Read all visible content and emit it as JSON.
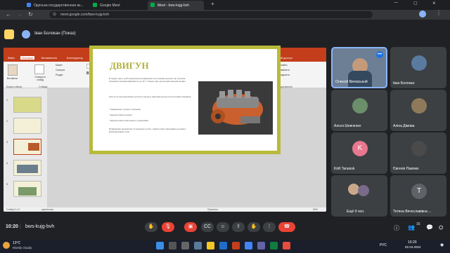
{
  "browser": {
    "tabs": [
      {
        "label": "Одеська государственная ак...",
        "active": false,
        "color": "#4285f4"
      },
      {
        "label": "Google Meet",
        "active": false,
        "color": "#00ac47"
      },
      {
        "label": "Meet - bws-kujg-bvh",
        "active": true,
        "color": "#00ac47"
      }
    ],
    "url": "meet.google.com/bws-kujg-bvh"
  },
  "meet_header": {
    "presenter": "Іван Болокан (Показ)"
  },
  "powerpoint": {
    "title": "ТЕМА 5 - PowerPoint",
    "share_button": "Поділ",
    "menu": [
      "Файл",
      "Основне",
      "Вставлення",
      "Конструктор",
      "Переходи",
      "Анімація",
      "Показ слайдів",
      "Рецензування",
      "Подання",
      "Довідка",
      "Foxit PDF",
      "Дизайнер",
      "Спільний доступ"
    ],
    "ribbon_groups": [
      "Буфер обміну",
      "Слайди",
      "Шрифт",
      "Абзац",
      "Малювання",
      "Редагування"
    ],
    "ribbon_buttons": [
      "Вставити",
      "Створити слайд",
      "Макет",
      "Скинути",
      "Розділ",
      "Фігури",
      "Упорядкувати",
      "Стилі фігур",
      "Знайти",
      "Замінити",
      "Виділити"
    ],
    "slide": {
      "title": "ДВИГУН",
      "paragraphs": [
        "В першу чергу треба відзначити розширення застосування дизелів, що дозволяє збільшити вантажопідйомність до 20 т і більше при одночасній економії палива.",
        "Робота по вдосконаленню робочого процесу двигунів ведеться в наступних напрямах:",
        "• підвищення ступеня стиснення;",
        "• використання наддуву;",
        "• використання електронного управління.",
        "Підвищення економічності покращує розгін і знижує вміст шкідливих речовин у відпрацьованих газах."
      ]
    },
    "status": {
      "slide_counter": "Слайд 3 з 9",
      "language": "українська",
      "notes": "Примітки",
      "zoom": "55%"
    },
    "thumbs": [
      "1",
      "2",
      "3",
      "4",
      "5"
    ],
    "selected_slide": 3
  },
  "participants": [
    {
      "name": "Олексій Виговськнй",
      "type": "video",
      "active": true
    },
    {
      "name": "Іван Болокан",
      "type": "video"
    },
    {
      "name": "Алєся Шевченко",
      "type": "avatar",
      "color": "#6b8e6b"
    },
    {
      "name": "Аліна Дімова",
      "type": "avatar",
      "color": "#8e7a5a"
    },
    {
      "name": "Kirill Tarasiuk",
      "type": "letter",
      "letter": "K",
      "color": "#e8778f"
    },
    {
      "name": "Євгенія Павлюк",
      "type": "avatar",
      "color": "#4a4a4a"
    },
    {
      "name": "Ещё 9 чел.",
      "type": "more"
    },
    {
      "name": "Тетяна Вячеславівна ...",
      "type": "letter",
      "letter": "T",
      "color": "#5f6368"
    }
  ],
  "meeting": {
    "time": "10:20",
    "code": "bws-kujg-bvh",
    "participant_count": "16"
  },
  "taskbar": {
    "weather_temp": "13°C",
    "weather_desc": "Mostly cloudy",
    "lang": "РУС",
    "clock_time": "10:20",
    "clock_date": "02.04.2024"
  }
}
